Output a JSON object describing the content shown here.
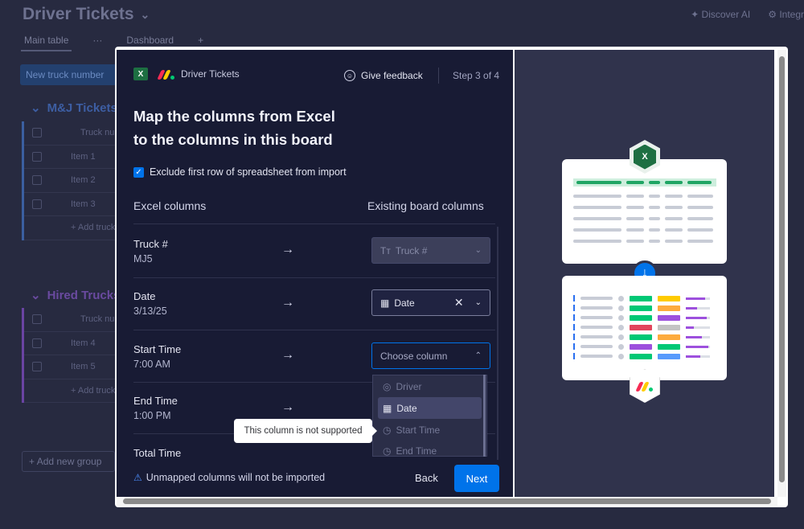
{
  "background": {
    "board_title": "Driver Tickets",
    "tabs": [
      "Main table",
      "Dashboard"
    ],
    "top_right": [
      "Discover AI",
      "Integr"
    ],
    "new_button": "New truck number",
    "groups": [
      {
        "name": "M&J Tickets",
        "header": "Truck nur",
        "items": [
          "Item 1",
          "Item 2",
          "Item 3"
        ],
        "add": "+ Add truck"
      },
      {
        "name": "Hired Trucks",
        "header": "Truck nur",
        "items": [
          "Item 4",
          "Item 5"
        ],
        "add": "+ Add truck"
      }
    ],
    "add_group": "Add new group"
  },
  "modal": {
    "app_name": "Driver Tickets",
    "excel_icon": "X",
    "feedback": "Give feedback",
    "step": "Step 3 of 4",
    "heading_line1": "Map the columns from Excel",
    "heading_line2": "to the columns in this board",
    "exclude_label": "Exclude first row of spreadsheet from import",
    "exclude_checked": true,
    "excel_columns_header": "Excel columns",
    "board_columns_header": "Existing board columns",
    "mappings": [
      {
        "name": "Truck #",
        "value": "MJ5",
        "target": "Truck #",
        "state": "disabled"
      },
      {
        "name": "Date",
        "value": "3/13/25",
        "target": "Date",
        "state": "set"
      },
      {
        "name": "Start Time",
        "value": "7:00 AM",
        "target": "Choose column",
        "state": "open"
      },
      {
        "name": "End Time",
        "value": "1:00 PM"
      },
      {
        "name": "Total Time",
        "value": ""
      }
    ],
    "dropdown_options": [
      "Driver",
      "Date",
      "Start Time",
      "End Time"
    ],
    "dropdown_highlighted": "Date",
    "tooltip": "This column is not supported",
    "footer_note": "Unmapped columns will not be imported",
    "back_label": "Back",
    "next_label": "Next"
  },
  "colors": {
    "accent": "#0073ea",
    "excel_green": "#1d6f42",
    "dark_bg": "#181b34"
  }
}
